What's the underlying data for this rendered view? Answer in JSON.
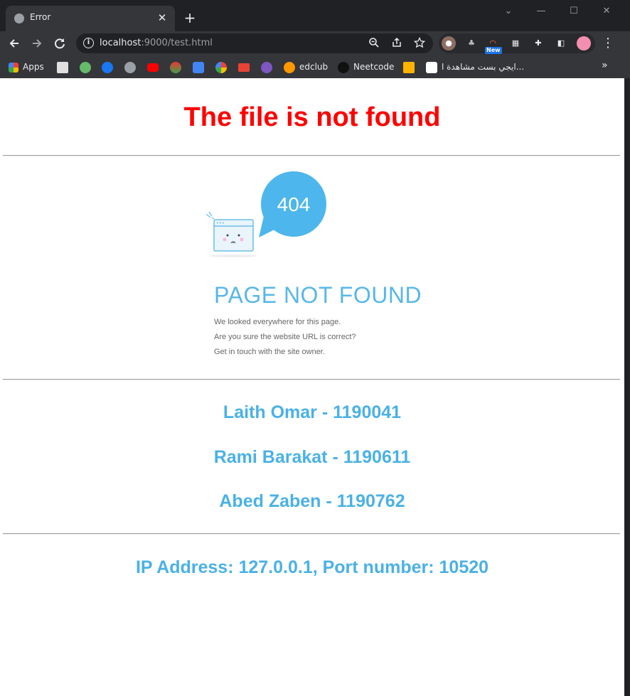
{
  "browser": {
    "tab_title": "Error",
    "tab_close": "✕",
    "new_tab": "+",
    "url_host": "localhost",
    "url_rest": ":9000/test.html",
    "window_controls": {
      "minimize": "—",
      "maximize": "☐",
      "close": "✕",
      "dropdown": "⌄"
    },
    "new_badge": "New",
    "bookmarks": [
      {
        "label": "Apps",
        "icon": "apps-grid-icon"
      },
      {
        "label": "edclub",
        "icon": "edclub-icon"
      },
      {
        "label": "Neetcode",
        "icon": "neetcode-icon"
      },
      {
        "label": "ايجي بست مشاهدة ا...",
        "icon": "egybest-icon"
      }
    ],
    "bookmarks_more": "»"
  },
  "page": {
    "title": "The file is not found",
    "illustration": {
      "bubble_text": "404",
      "heading": "PAGE NOT FOUND",
      "lines": [
        "We looked everywhere for this page.",
        "Are you sure the website URL is correct?",
        "Get in touch with the site owner."
      ]
    },
    "members": [
      "Laith Omar - 1190041",
      "Rami Barakat - 1190611",
      "Abed Zaben - 1190762"
    ],
    "footer": "IP Address: 127.0.0.1, Port number: 10520"
  },
  "colors": {
    "title": "#ff0000",
    "accent": "#4ab1e6",
    "chrome_dark": "#202124",
    "chrome_toolbar": "#35363a"
  }
}
